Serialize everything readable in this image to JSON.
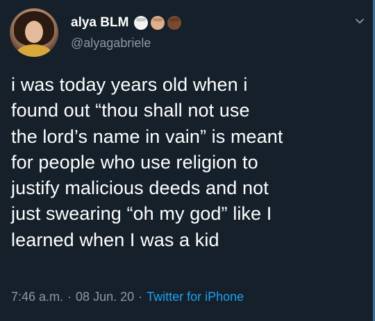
{
  "user": {
    "display_name": "alya BLM",
    "handle": "@alyagabriele",
    "emoji_icons": [
      "raised-fist-light-icon",
      "raised-fist-medium-icon",
      "raised-fist-dark-icon"
    ]
  },
  "tweet": {
    "text": "i was today years old when i\nfound out “thou shall not use\nthe lord’s name in vain” is meant\nfor people who use religion to\njustify malicious deeds and not\njust swearing “oh my god” like I\nlearned when I was a kid"
  },
  "meta": {
    "time": "7:46 a.m.",
    "separator": "·",
    "date": "08 Jun. 20",
    "source": "Twitter for iPhone"
  },
  "colors": {
    "background": "#15202b",
    "text": "#ffffff",
    "secondary": "#8899a6",
    "link": "#1da1f2"
  }
}
